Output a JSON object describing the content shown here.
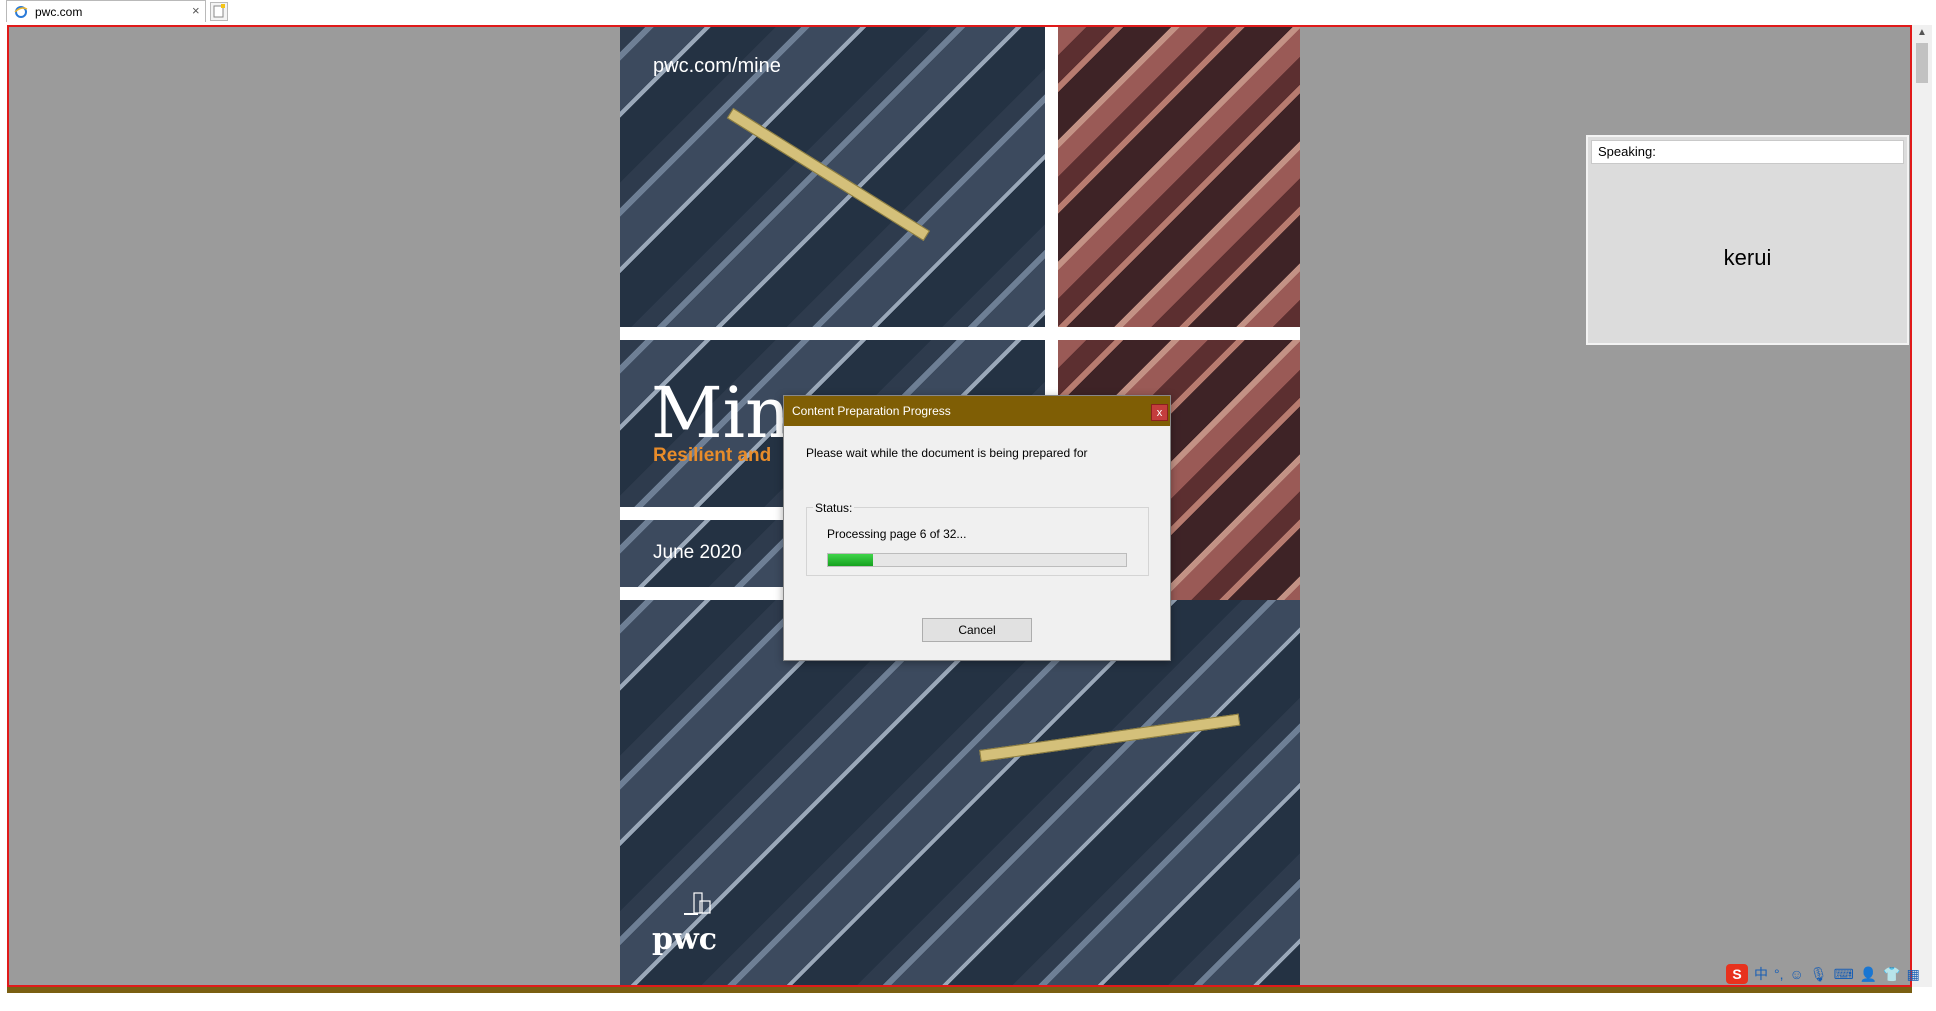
{
  "browser": {
    "tab_title": "pwc.com",
    "tab_close": "×"
  },
  "document": {
    "url_text": "pwc.com/mine",
    "title_text": "Mine",
    "subtitle_text": "Resilient and",
    "date_text": "June 2020",
    "logo_text": "pwc"
  },
  "speaking": {
    "label": "Speaking:",
    "name": "kerui"
  },
  "dialog": {
    "title": "Content Preparation Progress",
    "close_label": "x",
    "message": "Please wait while the document is being prepared for",
    "status_label": "Status:",
    "status_text": "Processing page 6 of 32...",
    "progress_fraction": 0.15,
    "cancel_label": "Cancel"
  },
  "tray": {
    "ime_logo": "S",
    "ime_mode": "中",
    "punct_mode": "°,",
    "icons": [
      "smiley-icon",
      "microphone-icon",
      "keyboard-icon",
      "user-icon",
      "shirt-icon",
      "grid-icon"
    ]
  },
  "colors": {
    "dialog_titlebar": "#7f5e05",
    "viewport_border": "#e01a1a",
    "progress_green": "#22b02c",
    "subtitle_orange": "#e88c2a"
  }
}
